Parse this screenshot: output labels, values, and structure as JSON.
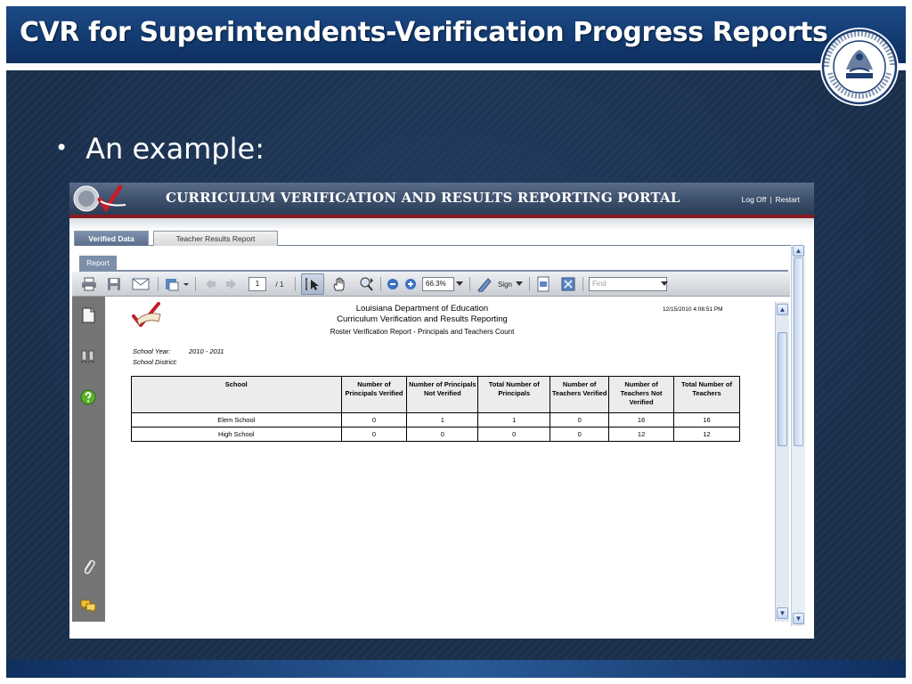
{
  "slide": {
    "title": "CVR for Superintendents-Verification Progress Reports",
    "bullet": "An example:",
    "bullet_symbol": "•",
    "seal_ring_text": "STATE OF LOUISIANA DEPARTMENT OF EDUCATION",
    "seal_banner": "UNION JUSTICE CONFIDENCE",
    "colors": {
      "title_bar": "#123a70",
      "background": "#1a2f4c",
      "text": "#ffffff"
    }
  },
  "portal": {
    "title": "CURRICULUM VERIFICATION AND RESULTS REPORTING PORTAL",
    "links": {
      "logoff": "Log Off",
      "separator": "|",
      "restart": "Restart"
    },
    "tabs": [
      {
        "label": "Verified Data",
        "active": true
      },
      {
        "label": "Teacher Results Report",
        "active": false
      }
    ],
    "subtab": "Report",
    "toolbar": {
      "page_current": "1",
      "page_total": "/ 1",
      "zoom": "66.3%",
      "sign_label": "Sign",
      "find_placeholder": "Find",
      "icons": [
        "print-icon",
        "save-icon",
        "email-icon",
        "export-icon",
        "previous-page-icon",
        "next-page-icon",
        "select-tool-icon",
        "hand-tool-icon",
        "marquee-zoom-icon",
        "zoom-out-icon",
        "zoom-in-icon",
        "sign-icon",
        "fit-page-icon",
        "full-screen-icon"
      ]
    },
    "left_panel_icons": [
      "pages-icon",
      "bookmarks-icon",
      "help-icon",
      "attachments-icon",
      "comments-icon"
    ]
  },
  "report": {
    "org": "Louisiana Department of Education",
    "subtitle": "Curriculum Verification and Results Reporting",
    "report_title": "Roster Verification Report - Principals and Teachers Count",
    "timestamp": "12/15/2010 4:08:51 PM",
    "school_year_label": "School Year:",
    "school_year": "2010 - 2011",
    "school_district_label": "School District:",
    "columns": [
      "School",
      "Number of Principals Verified",
      "Number of Principals Not Verified",
      "Total Number of Principals",
      "Number of Teachers Verified",
      "Number of Teachers Not Verified",
      "Total Number of Teachers"
    ],
    "rows": [
      [
        "Elem School",
        "0",
        "1",
        "1",
        "0",
        "16",
        "16"
      ],
      [
        "High School",
        "0",
        "0",
        "0",
        "0",
        "12",
        "12"
      ]
    ]
  }
}
